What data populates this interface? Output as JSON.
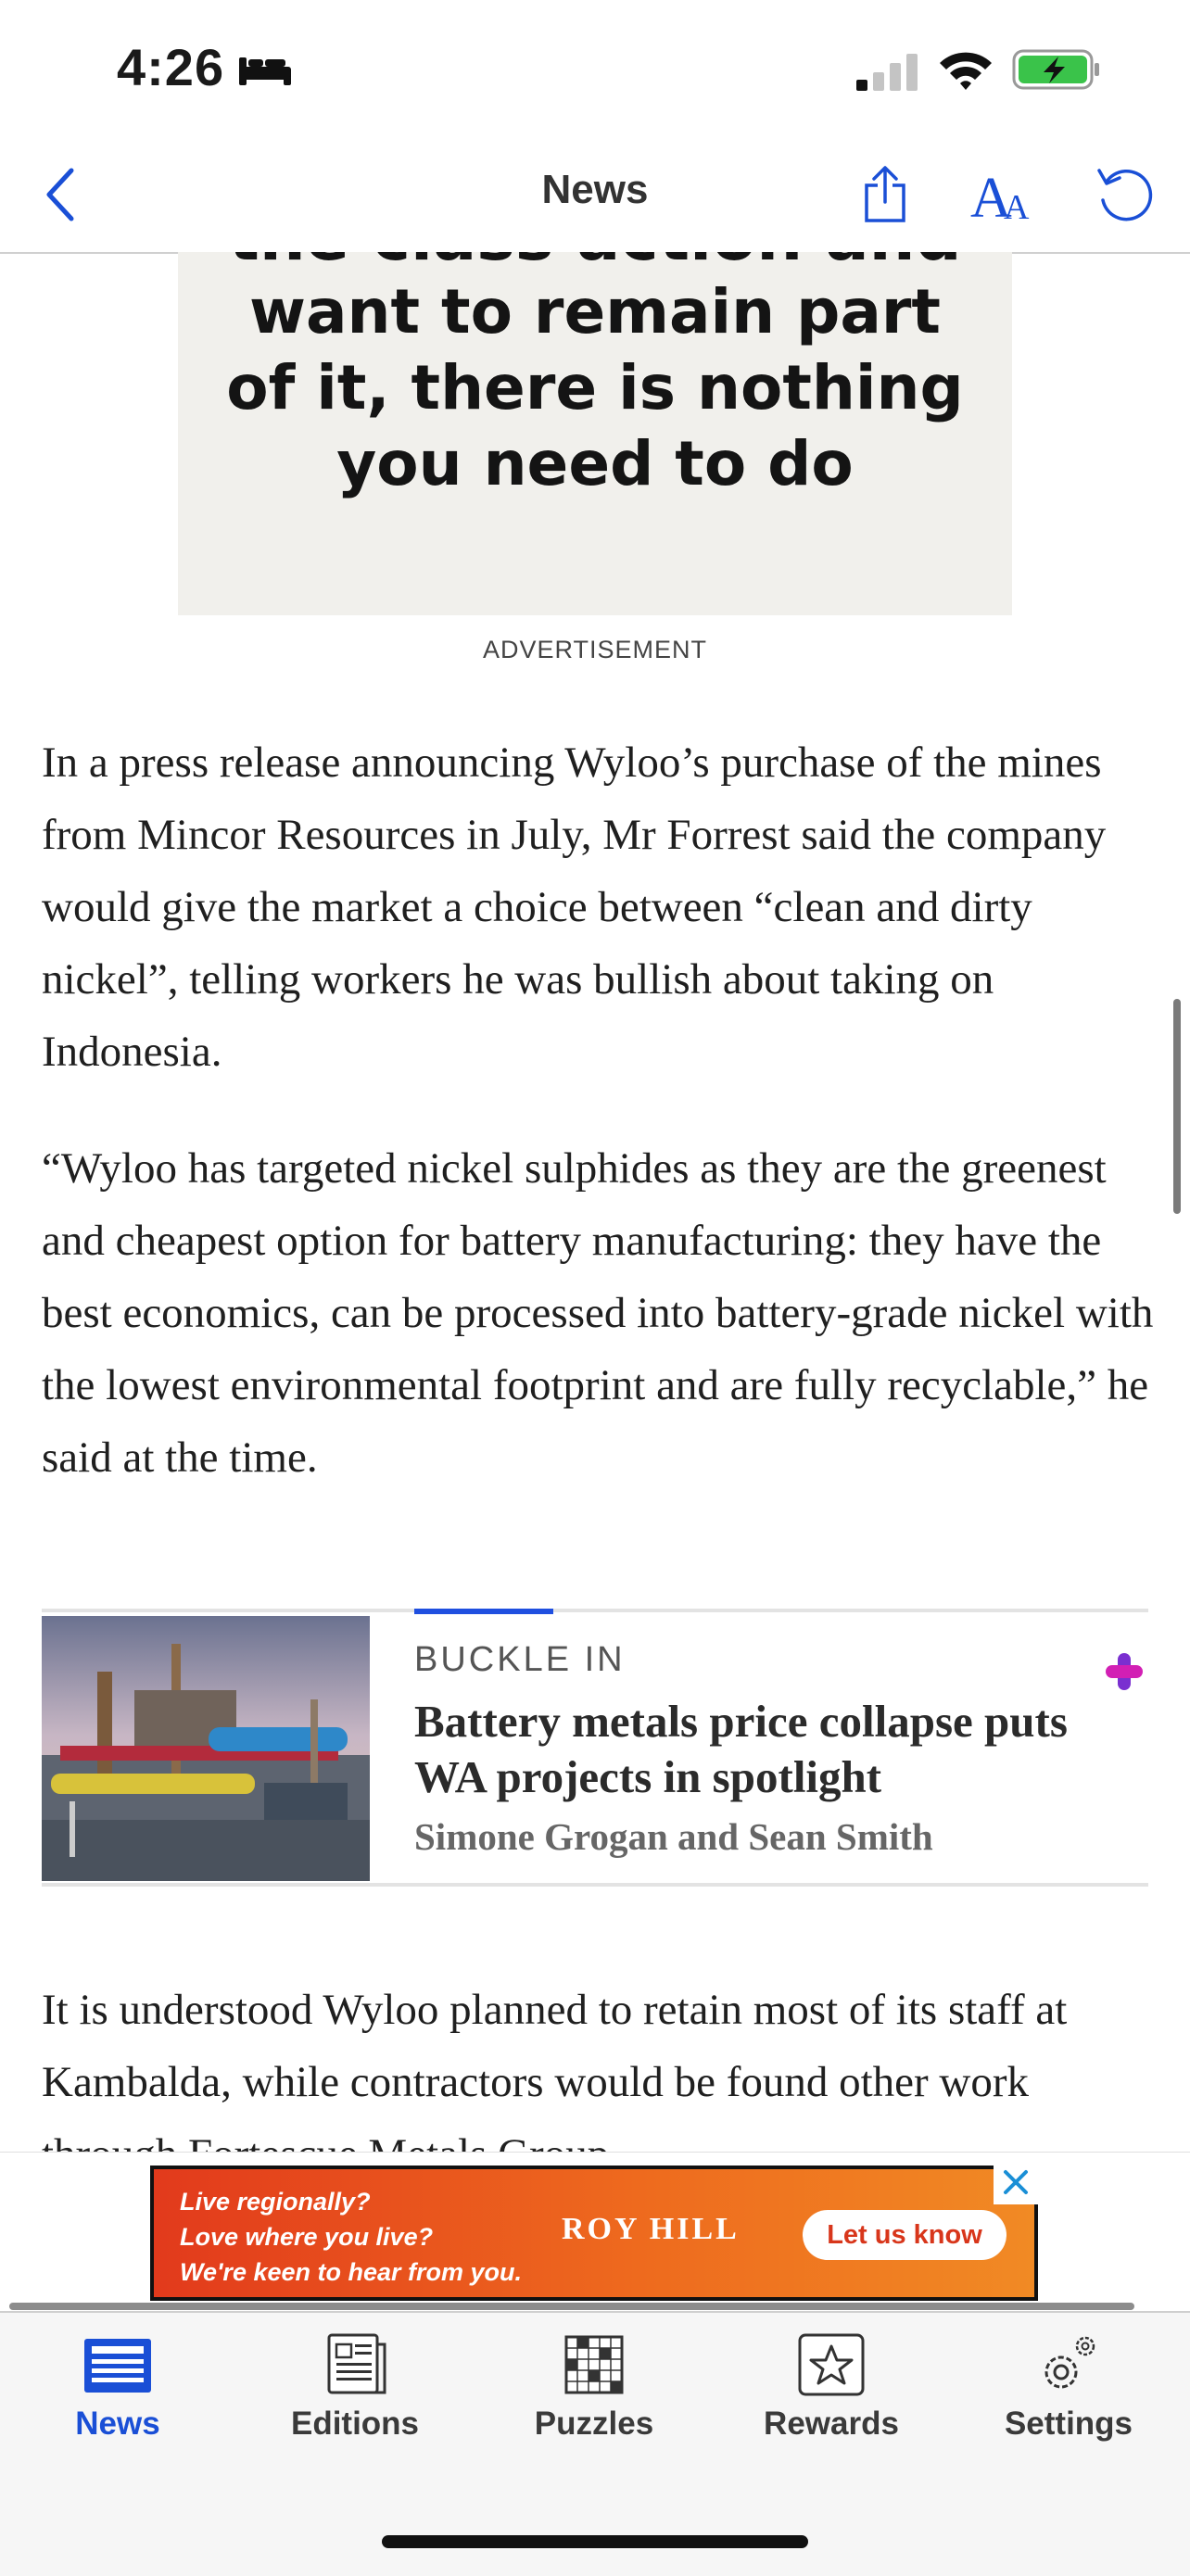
{
  "status_bar": {
    "time": "4:26"
  },
  "nav": {
    "title": "News"
  },
  "ad_image": {
    "cut_line": "the class action and",
    "lines": [
      "want to remain part",
      "of it, there is nothing",
      "you need to do"
    ]
  },
  "ad_label": "ADVERTISEMENT",
  "article": {
    "p1": "In a press release announcing Wyloo’s purchase of the mines from Mincor Resources in July, Mr Forrest said the company would give the market a choice between “clean and dirty nickel”, telling workers he was bullish about taking on Indonesia.",
    "p2": "“Wyloo has targeted nickel sulphides as they are the greenest and cheapest option for battery manufacturing: they have the best economics, can be processed into battery-grade nickel with the lowest environmental footprint and are fully recyclable,” he said at the time.",
    "p3": "It is understood Wyloo planned to retain most of its staff at Kambalda, while contractors would be found other work through Fortescue Metals Group."
  },
  "related": {
    "kicker": "BUCKLE IN",
    "title": "Battery metals price collapse puts WA projects in spotlight",
    "authors": "Simone Grogan and Sean Smith"
  },
  "banner": {
    "lines": [
      "Live regionally?",
      "Love where you live?",
      "We're keen to hear from you."
    ],
    "brand": "ROY HILL",
    "cta": "Let us know"
  },
  "tabs": [
    {
      "label": "News",
      "icon": "news-icon",
      "active": true
    },
    {
      "label": "Editions",
      "icon": "editions-icon"
    },
    {
      "label": "Puzzles",
      "icon": "puzzles-icon"
    },
    {
      "label": "Rewards",
      "icon": "rewards-icon"
    },
    {
      "label": "Settings",
      "icon": "settings-icon"
    }
  ],
  "colors": {
    "accent": "#1f4fe0",
    "banner": "#e8481d",
    "plus_magenta": "#d21fb4"
  }
}
